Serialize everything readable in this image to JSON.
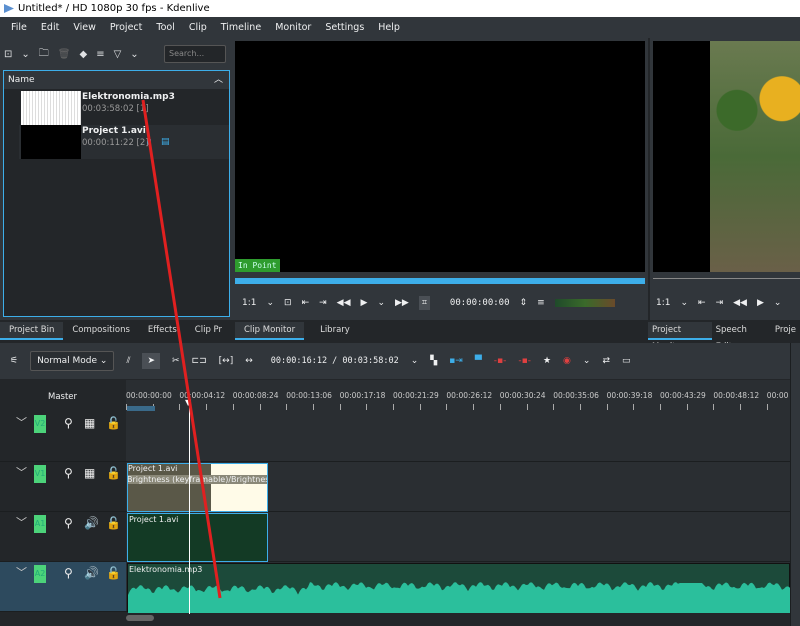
{
  "window": {
    "title": "Untitled* / HD 1080p 30 fps - Kdenlive"
  },
  "menu": [
    "File",
    "Edit",
    "View",
    "Project",
    "Tool",
    "Clip",
    "Timeline",
    "Monitor",
    "Settings",
    "Help"
  ],
  "bin": {
    "search_placeholder": "Search...",
    "column": "Name",
    "items": [
      {
        "name": "Elektronomia.mp3",
        "duration": "00:03:58:02 [1]"
      },
      {
        "name": "Project 1.avi",
        "duration": "00:00:11:22 [2]"
      }
    ]
  },
  "left_tabs": [
    "Project Bin",
    "Compositions",
    "Effects",
    "Clip Pr"
  ],
  "clip_monitor": {
    "in_point": "In Point",
    "zoom": "1:1",
    "timecode": "00:00:00:00",
    "tabs": [
      "Clip Monitor",
      "Library"
    ]
  },
  "project_monitor": {
    "zoom": "1:1",
    "tabs": [
      "Project Monitor",
      "Speech Editor",
      "Proje"
    ]
  },
  "timeline": {
    "mode": "Normal Mode",
    "position": "00:00:16:12 / 00:03:58:02",
    "master": "Master",
    "ruler": [
      "00:00:00:00",
      "00:00:04:12",
      "00:00:08:24",
      "00:00:13:06",
      "00:00:17:18",
      "00:00:21:29",
      "00:00:26:12",
      "00:00:30:24",
      "00:00:35:06",
      "00:00:39:18",
      "00:00:43:29",
      "00:00:48:12",
      "00:00"
    ],
    "tracks": [
      {
        "tag": "V2",
        "type": "video"
      },
      {
        "tag": "V1",
        "type": "video"
      },
      {
        "tag": "A1",
        "type": "audio"
      },
      {
        "tag": "A2",
        "type": "audio"
      }
    ],
    "clips": {
      "v1_name": "Project 1.avi",
      "v1_effect": "Brightness (keyframable)/Brightness (k",
      "a1_name": "Project 1.avi",
      "a2_name": "Elektronomia.mp3"
    }
  },
  "colors": {
    "accent": "#3daee9",
    "track_tag": "#4cd37a",
    "audio_clip": "#2bbf9c",
    "annotation": "#e02020"
  }
}
